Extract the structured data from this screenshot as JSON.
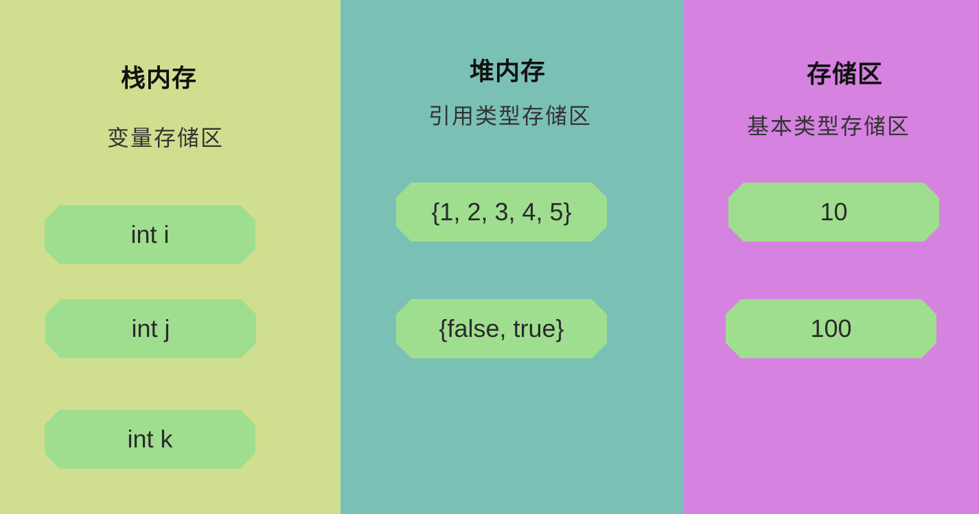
{
  "columns": [
    {
      "title": "栈内存",
      "subtitle": "变量存储区",
      "color": "#d0df8f",
      "cells": [
        "int i",
        "int j",
        "int k"
      ]
    },
    {
      "title": "堆内存",
      "subtitle": "引用类型存储区",
      "color": "#7bc0b5",
      "cells": [
        "{1, 2, 3, 4, 5}",
        "{false, true}"
      ]
    },
    {
      "title": "存储区",
      "subtitle": "基本类型存储区",
      "color": "#d582e0",
      "cells": [
        "10",
        "100"
      ]
    }
  ],
  "cell_color": "#9fde8f"
}
